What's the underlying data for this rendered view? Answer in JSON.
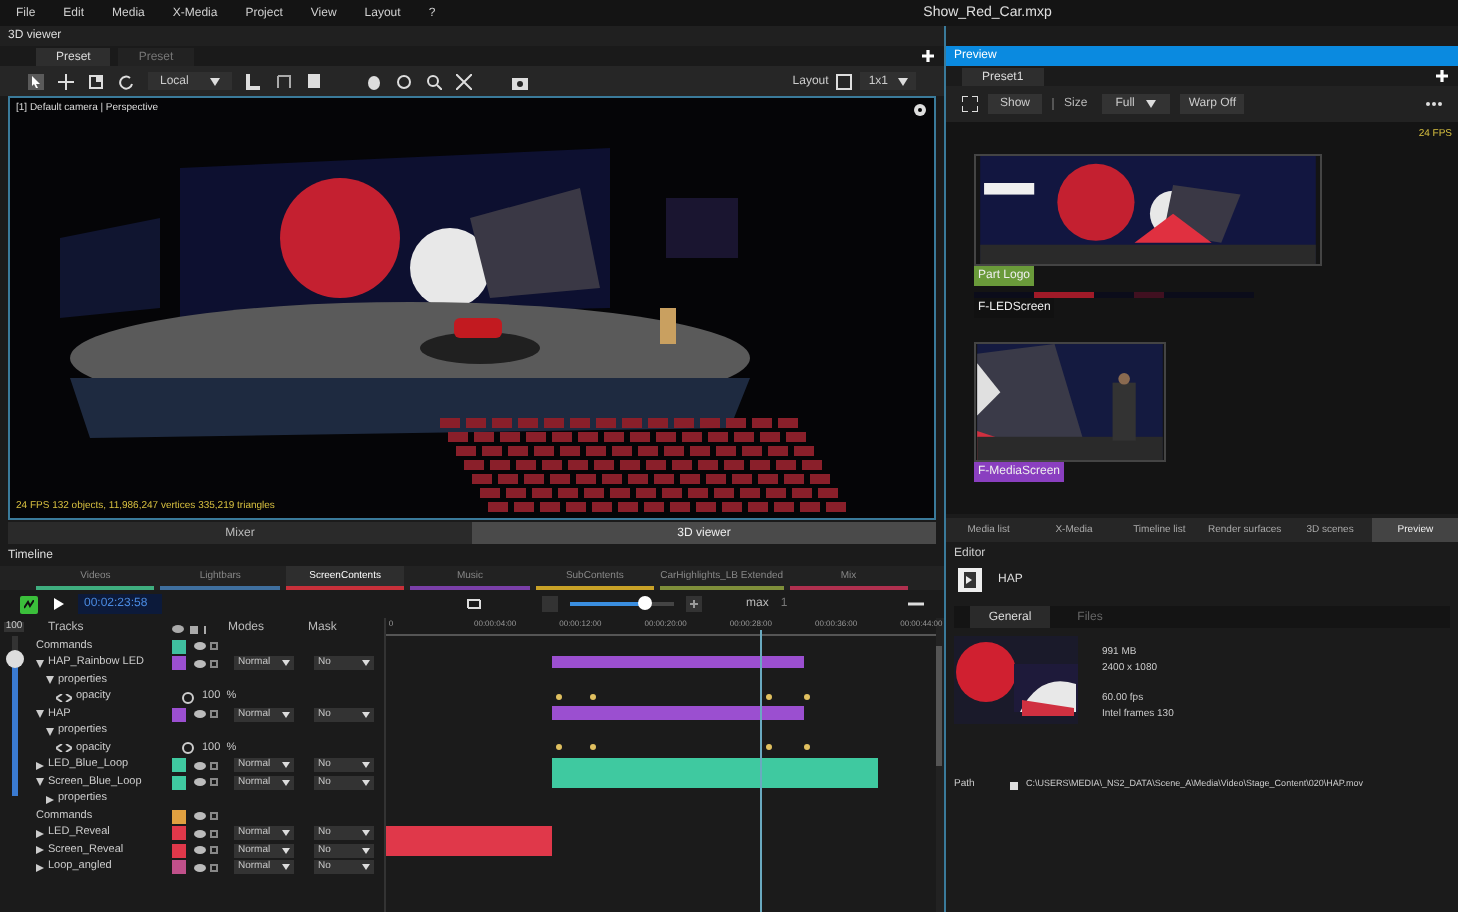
{
  "menu": [
    "File",
    "Edit",
    "Media",
    "X-Media",
    "Project",
    "View",
    "Layout",
    "?"
  ],
  "window": {
    "title": "Show_Red_Car.mxp"
  },
  "viewer": {
    "title": "3D viewer",
    "tabs": [
      {
        "label": "Preset",
        "selected": true
      },
      {
        "label": "Preset",
        "selected": false
      }
    ],
    "mode": "Local",
    "layout_label": "Layout",
    "layout": "1x1",
    "camera": "[1] Default camera | Perspective",
    "stats": "24 FPS 132 objects, 11,986,247 vertices 335,219 triangles"
  },
  "bottom_tabs": [
    {
      "label": "Mixer",
      "selected": false
    },
    {
      "label": "3D viewer",
      "selected": true
    }
  ],
  "timeline": {
    "title": "Timeline",
    "groups": [
      {
        "label": "Videos",
        "color": "#3fae7f",
        "selected": false
      },
      {
        "label": "Lightbars",
        "color": "#3f6f9f",
        "selected": false
      },
      {
        "label": "ScreenContents",
        "color": "#c8303a",
        "selected": true
      },
      {
        "label": "Music",
        "color": "#7a3fa8",
        "selected": false
      },
      {
        "label": "SubContents",
        "color": "#c9a227",
        "selected": false
      },
      {
        "label": "CarHighlights_LB Extended",
        "color": "#7f8f3a",
        "selected": false
      },
      {
        "label": "Mix",
        "color": "#b0304f",
        "selected": false
      }
    ],
    "time": "00:02:23:58",
    "zoom": {
      "level": 0.72
    },
    "zoom_label": "max",
    "zoom_value": "1",
    "master": {
      "level": 0.85,
      "value": "100"
    },
    "columns": [
      "Tracks",
      "Modes",
      "Mask"
    ],
    "ticks": [
      "0",
      "00:00:04:00",
      "00:00:12:00",
      "00:00:20:00",
      "00:00:28:00",
      "00:00:36:00",
      "00:00:44:00"
    ],
    "tracks": [
      {
        "kind": "command",
        "name": "Commands",
        "color": "#3fbf9f"
      },
      {
        "kind": "track",
        "name": "HAP_Rainbow LED",
        "color": "#9b4fd0",
        "expanded": true,
        "mode": "Normal",
        "mask": "No",
        "children": [
          {
            "kind": "group",
            "name": "properties",
            "expanded": true,
            "children": [
              {
                "kind": "param",
                "name": "opacity",
                "value": "100",
                "unit": "%"
              }
            ]
          }
        ]
      },
      {
        "kind": "track",
        "name": "HAP",
        "color": "#9b4fd0",
        "expanded": true,
        "mode": "Normal",
        "mask": "No",
        "children": [
          {
            "kind": "group",
            "name": "properties",
            "expanded": true,
            "children": [
              {
                "kind": "param",
                "name": "opacity",
                "value": "100",
                "unit": "%"
              }
            ]
          }
        ]
      },
      {
        "kind": "track",
        "name": "LED_Blue_Loop",
        "color": "#3fc9a0",
        "expanded": false,
        "mode": "Normal",
        "mask": "No"
      },
      {
        "kind": "track",
        "name": "Screen_Blue_Loop",
        "color": "#3fc9a0",
        "expanded": true,
        "mode": "Normal",
        "mask": "No",
        "children": [
          {
            "kind": "group",
            "name": "properties",
            "expanded": false
          }
        ]
      },
      {
        "kind": "command",
        "name": "Commands",
        "color": "#e0a040"
      },
      {
        "kind": "track",
        "name": "LED_Reveal",
        "color": "#e0384a",
        "expanded": false,
        "mode": "Normal",
        "mask": "No"
      },
      {
        "kind": "track",
        "name": "Screen_Reveal",
        "color": "#e0384a",
        "expanded": false,
        "mode": "Normal",
        "mask": "No"
      },
      {
        "kind": "track",
        "name": "Loop_angled",
        "color": "#c0508a",
        "expanded": false,
        "mode": "Normal",
        "mask": "No"
      }
    ]
  },
  "preview": {
    "title": "Preview",
    "tabs": [
      {
        "label": "Preset1",
        "selected": true
      }
    ],
    "buttons": [
      "Show",
      "Size"
    ],
    "size": "Full",
    "warp": "Warp Off",
    "fps": "24 FPS",
    "surfaces": [
      {
        "label": "Part Logo",
        "color": "#6a9a3a"
      },
      {
        "label": "F-LEDScreen",
        "color": "#111111"
      },
      {
        "label": "F-MediaScreen",
        "color": "#8a3fc0"
      }
    ]
  },
  "lower_tabs": [
    {
      "label": "Media list",
      "selected": false
    },
    {
      "label": "X-Media",
      "selected": false
    },
    {
      "label": "Timeline list",
      "selected": false
    },
    {
      "label": "Render surfaces",
      "selected": false
    },
    {
      "label": "3D scenes",
      "selected": false
    },
    {
      "label": "Preview",
      "selected": true
    }
  ],
  "editor": {
    "title": "Editor",
    "name": "HAP",
    "tabs": [
      {
        "label": "General",
        "selected": true
      },
      {
        "label": "Files",
        "selected": false
      }
    ],
    "info": [
      [
        "991 MB",
        "2400 x 1080"
      ],
      [
        "60.00 fps",
        "Intel frames 130"
      ]
    ],
    "path_label": "Path",
    "path": "C:\\USERS\\MEDIA\\_NS2_DATA\\Scene_A\\Media\\Video\\Stage_Content\\020\\HAP.mov"
  }
}
